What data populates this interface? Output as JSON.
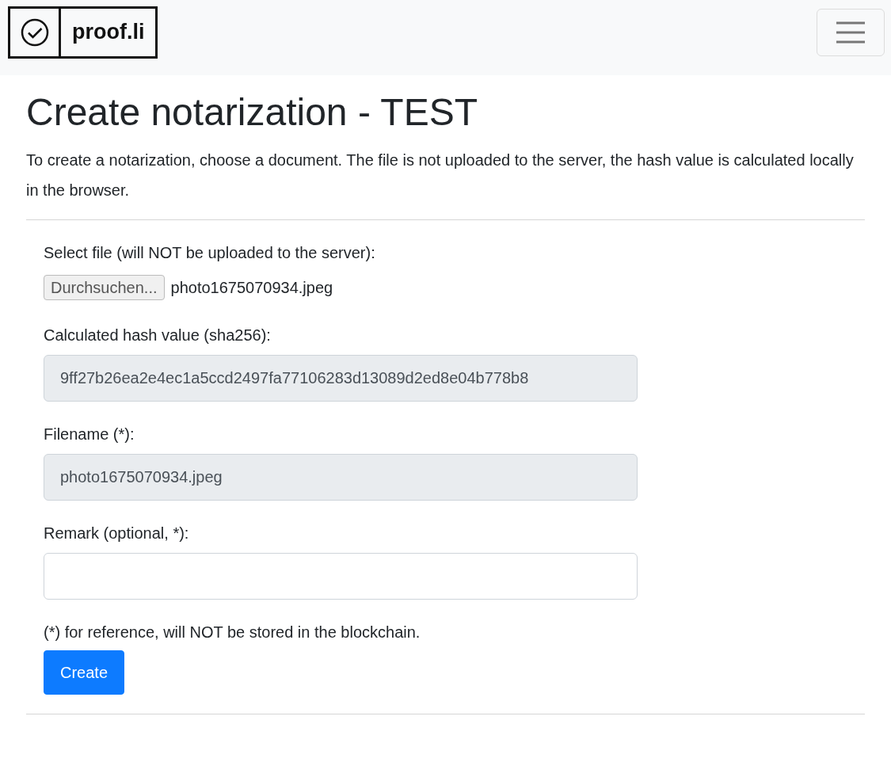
{
  "navbar": {
    "brand": "proof.li"
  },
  "heading": "Create notarization - TEST",
  "intro": "To create a notarization, choose a document. The file is not uploaded to the server, the hash value is calculated locally in the browser.",
  "file_input": {
    "label": "Select file (will NOT be uploaded to the server):",
    "button": "Durchsuchen...",
    "file_name": "photo1675070934.jpeg"
  },
  "fields": [
    {
      "label": "Calculated hash value (sha256):",
      "value": "9ff27b26ea2e4ec1a5ccd2497fa77106283d13089d2ed8e04b778b8",
      "disabled": true
    },
    {
      "label": "Filename (*):",
      "value": "photo1675070934.jpeg",
      "disabled": true
    },
    {
      "label": "Remark (optional, *):",
      "disabled": false
    }
  ],
  "note": "(*) for reference, will NOT be stored in the blockchain.",
  "submit_button": "Create"
}
